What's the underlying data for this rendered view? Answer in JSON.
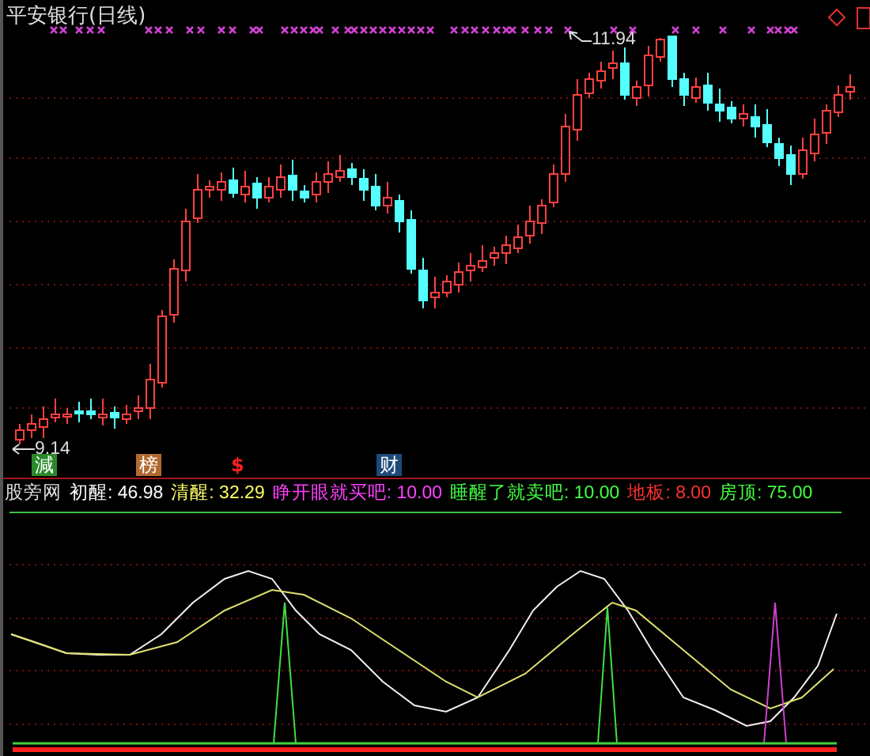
{
  "chart": {
    "title": "平安银行(日线)",
    "high_label": "11.94",
    "low_label": "9.14"
  },
  "signals": [
    {
      "text": "減",
      "color": "#2a8a2a"
    },
    {
      "text": "榜",
      "color": "#b06a30"
    },
    {
      "text": "$",
      "color": "#000000"
    },
    {
      "text": "财",
      "color": "#1e4a7a"
    }
  ],
  "indicator": {
    "name": "股旁网",
    "items": [
      {
        "text": "初醒: 46.98",
        "color": "#ffffff"
      },
      {
        "text": "清醒: 32.29",
        "color": "#ffff66"
      },
      {
        "text": "睁开眼就买吧: 10.00",
        "color": "#ff40ff"
      },
      {
        "text": "睡醒了就卖吧: 10.00",
        "color": "#40ff40"
      },
      {
        "text": "地板: 8.00",
        "color": "#ff3030"
      },
      {
        "text": "房顶: 75.00",
        "color": "#40ff40"
      }
    ]
  }
}
